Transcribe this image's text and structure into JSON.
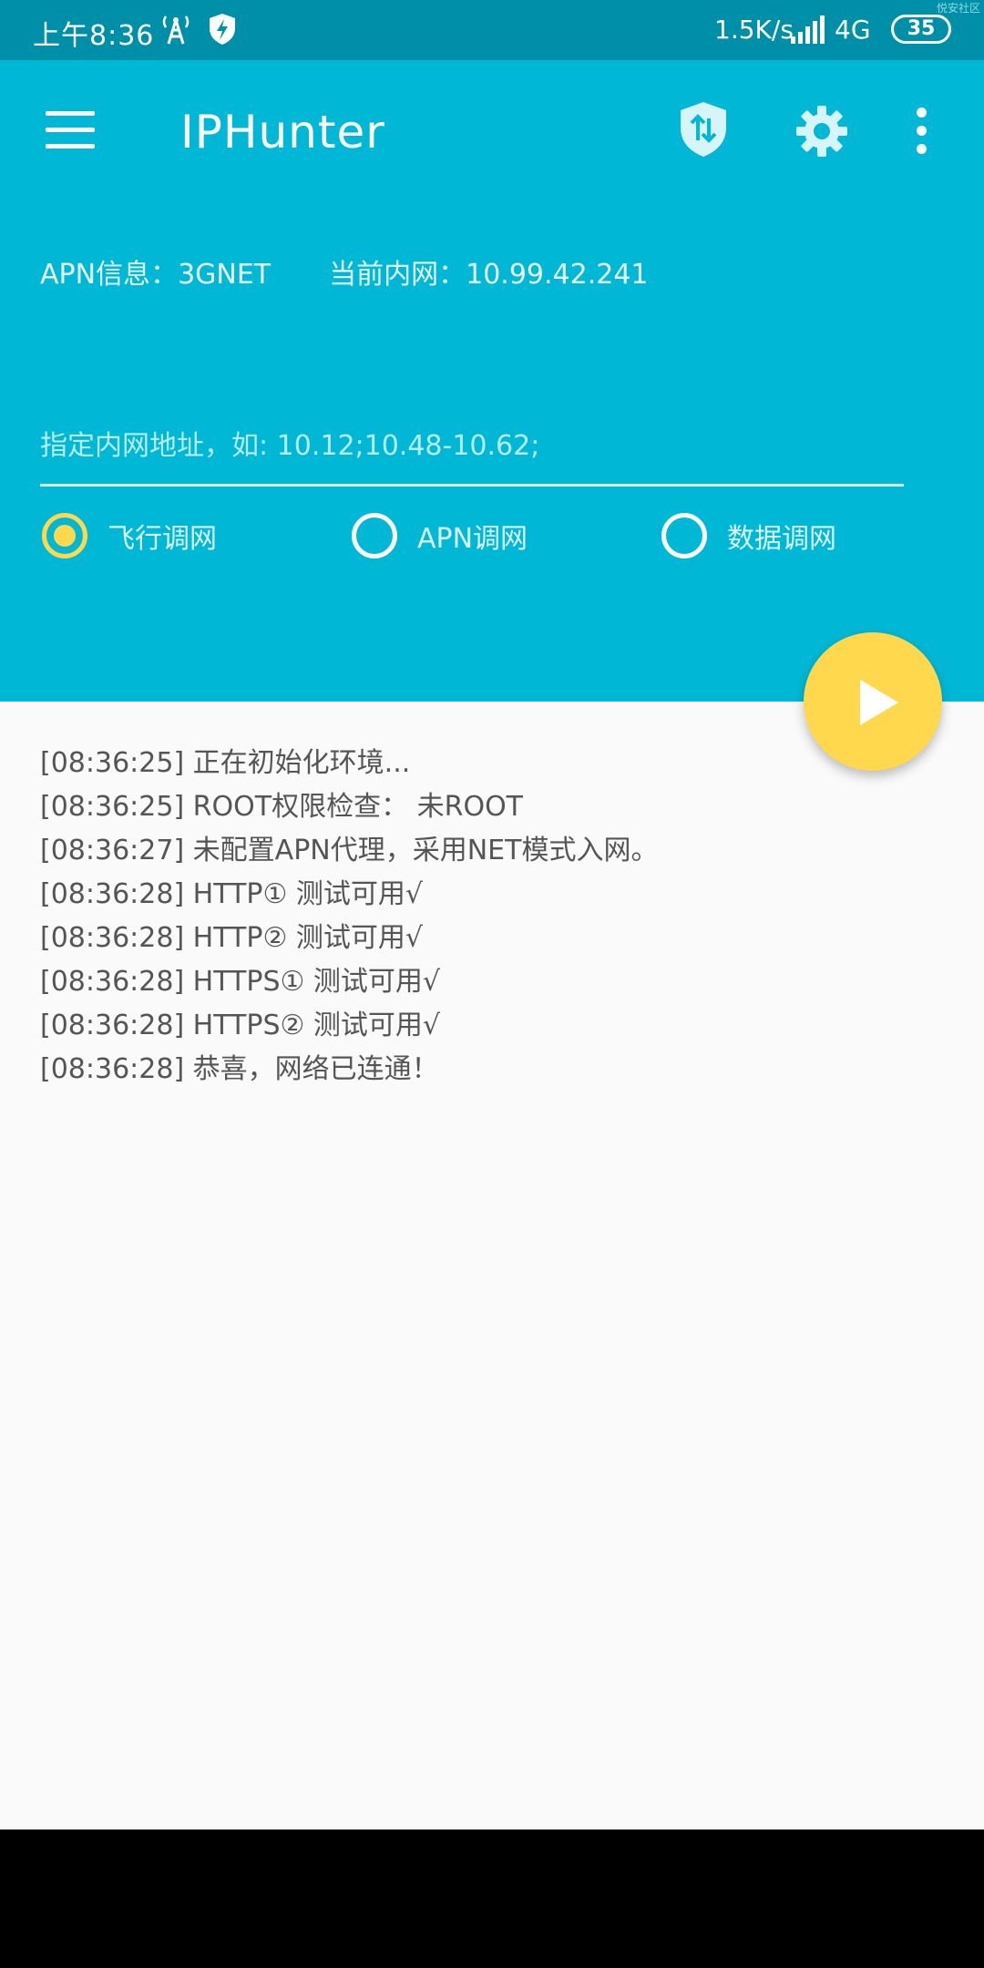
{
  "status_bar": {
    "time": "上午8:36",
    "net_speed": "1.5K/s",
    "network_type": "4G",
    "battery": "35",
    "corner_mark": "悦安社区"
  },
  "header": {
    "title": "IPHunter",
    "apn_label": "APN信息：",
    "apn_value": "3GNET",
    "intranet_label": "当前内网：",
    "intranet_value": "10.99.42.241",
    "input_placeholder": "指定内网地址，如: 10.12;10.48-10.62;",
    "input_value": ""
  },
  "modes": [
    {
      "label": "飞行调网",
      "checked": true
    },
    {
      "label": "APN调网",
      "checked": false
    },
    {
      "label": "数据调网",
      "checked": false
    }
  ],
  "log": [
    "[08:36:25] 正在初始化环境...",
    "[08:36:25] ROOT权限检查：  未ROOT",
    "[08:36:27] 未配置APN代理，采用NET模式入网。",
    "[08:36:28] HTTP①    测试可用√",
    "[08:36:28] HTTP②    测试可用√",
    "[08:36:28] HTTPS① 测试可用√",
    "[08:36:28] HTTPS② 测试可用√",
    "[08:36:28] 恭喜，网络已连通！"
  ],
  "colors": {
    "status_bar": "#008fa8",
    "primary": "#00b8d6",
    "accent": "#ffd84d",
    "background": "#fafafa"
  },
  "icons": {
    "menu": "menu-icon",
    "vpn": "shield-transfer-icon",
    "settings": "gear-icon",
    "more": "more-vert-icon",
    "fab": "play-icon"
  }
}
